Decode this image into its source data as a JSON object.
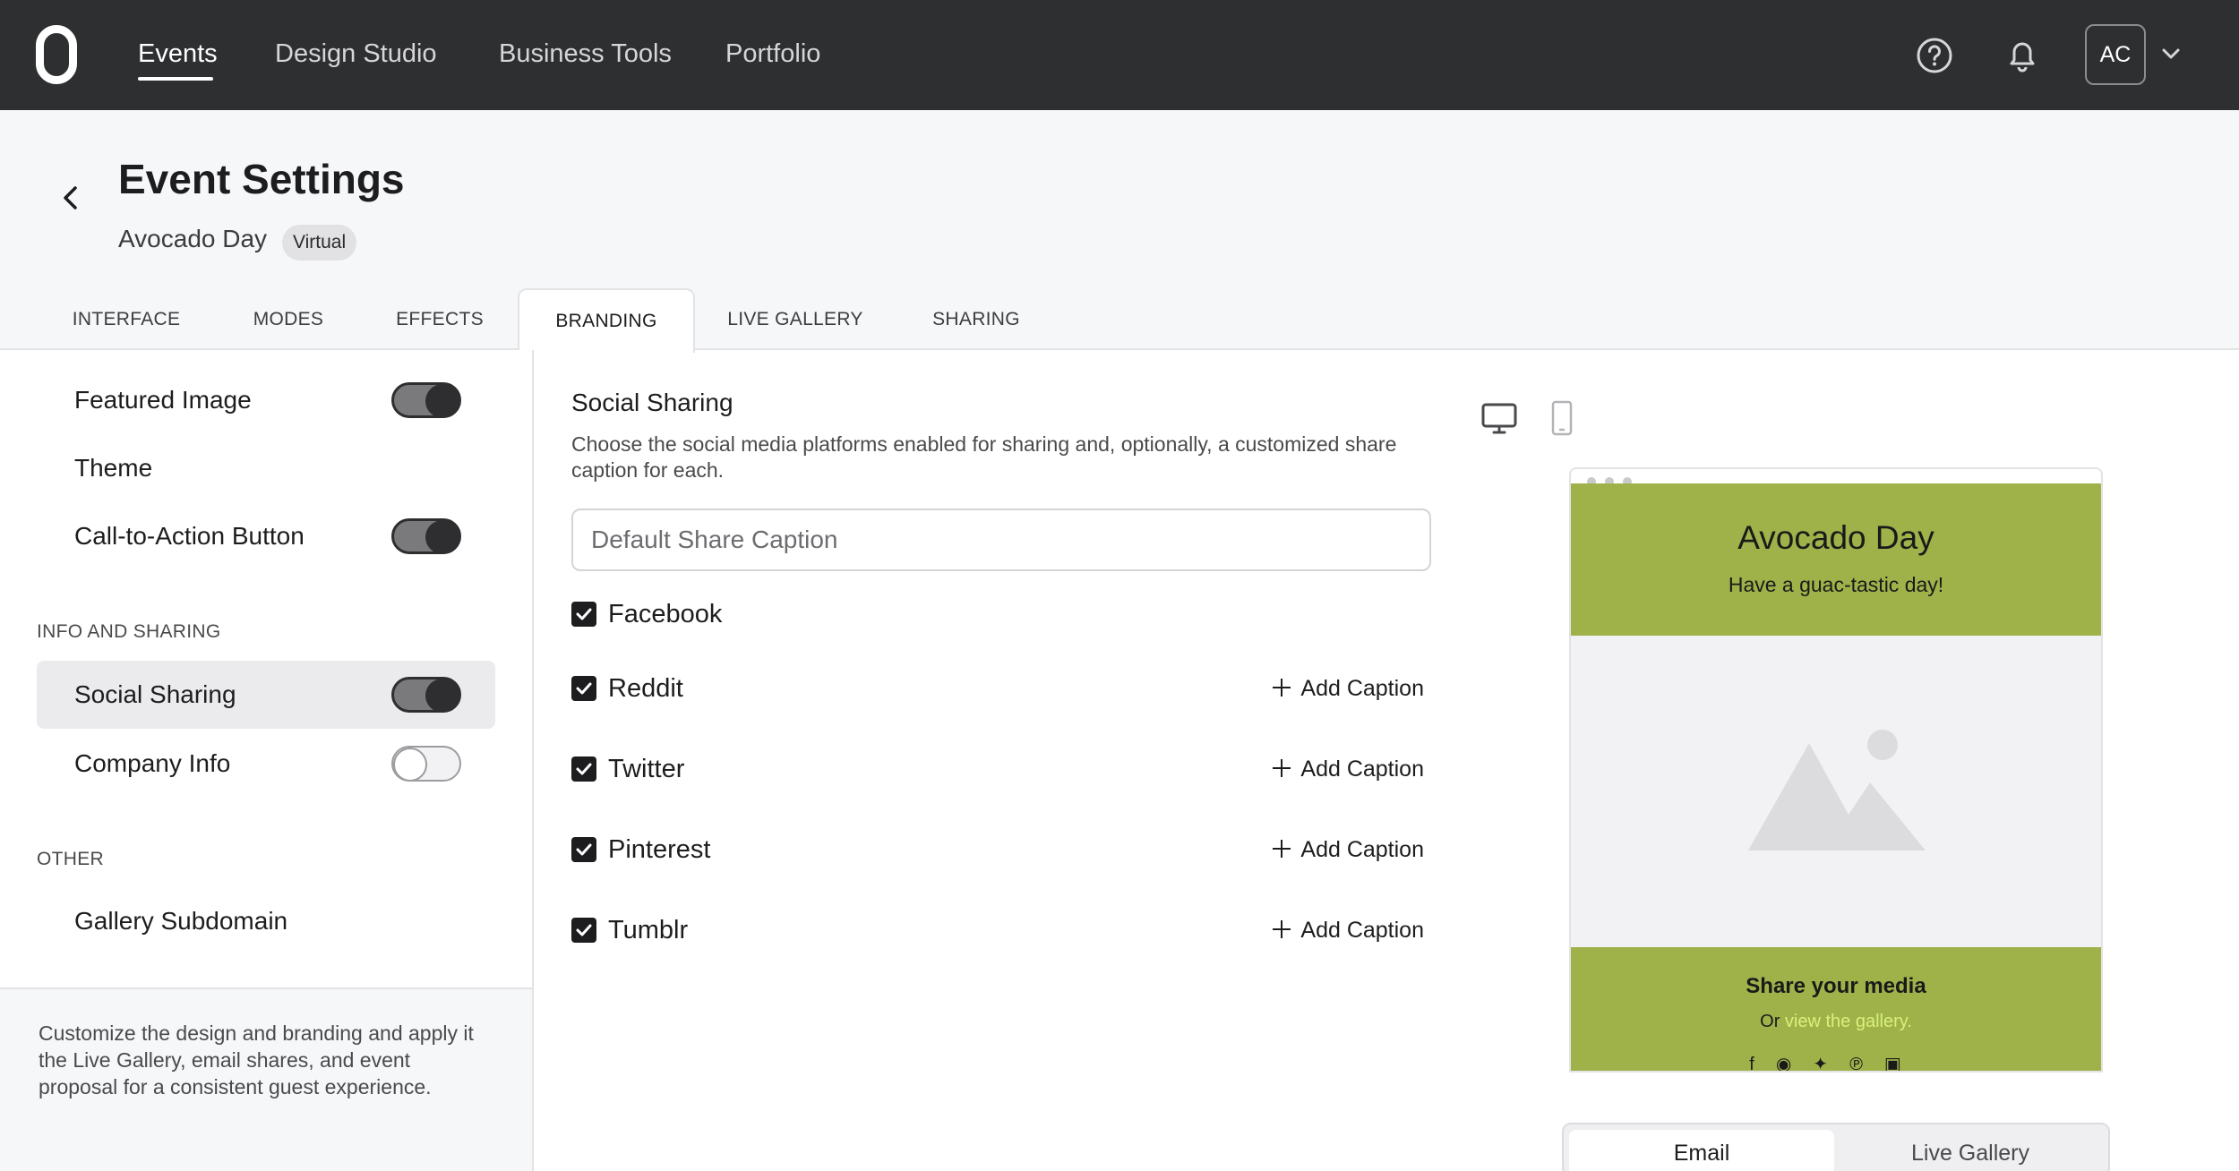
{
  "topbar": {
    "logo_icon": "logo-icon",
    "nav": [
      "Events",
      "Design Studio",
      "Business Tools",
      "Portfolio"
    ],
    "active_nav": "Events",
    "avatar_initials": "AC"
  },
  "header": {
    "title": "Event Settings",
    "event_name": "Avocado Day",
    "event_type_badge": "Virtual",
    "tabs": [
      "INTERFACE",
      "MODES",
      "EFFECTS",
      "BRANDING",
      "LIVE GALLERY",
      "SHARING"
    ],
    "active_tab": "BRANDING"
  },
  "sidebar": {
    "items": [
      {
        "label": "Featured Image",
        "toggle": "on"
      },
      {
        "label": "Theme"
      },
      {
        "label": "Call-to-Action Button",
        "toggle": "on"
      }
    ],
    "section_info": "INFO AND SHARING",
    "info_items": [
      {
        "label": "Social Sharing",
        "toggle": "on",
        "selected": true
      },
      {
        "label": "Company Info",
        "toggle": "off"
      }
    ],
    "section_other": "OTHER",
    "other_items": [
      {
        "label": "Gallery Subdomain"
      }
    ],
    "footer_text": "Customize the design and branding and apply it the Live Gallery, email shares, and event proposal for a consistent guest experience."
  },
  "main": {
    "title": "Social Sharing",
    "description": "Choose the social media platforms enabled for sharing and, optionally, a customized share caption for each.",
    "caption_placeholder": "Default Share Caption",
    "add_caption_label": "Add Caption",
    "platforms": [
      {
        "name": "Facebook",
        "checked": true
      },
      {
        "name": "Reddit",
        "checked": true
      },
      {
        "name": "Twitter",
        "checked": true
      },
      {
        "name": "Pinterest",
        "checked": true
      },
      {
        "name": "Tumblr",
        "checked": true
      }
    ]
  },
  "preview": {
    "title": "Avocado Day",
    "subtitle": "Have a guac-tastic day!",
    "footer_title": "Share your media",
    "footer_prefix": "Or",
    "footer_link": "view the gallery.",
    "accent_color": "#9fb24a",
    "link_color": "#d8f07a",
    "modes": [
      "Email",
      "Live Gallery"
    ],
    "active_mode": "Email"
  }
}
